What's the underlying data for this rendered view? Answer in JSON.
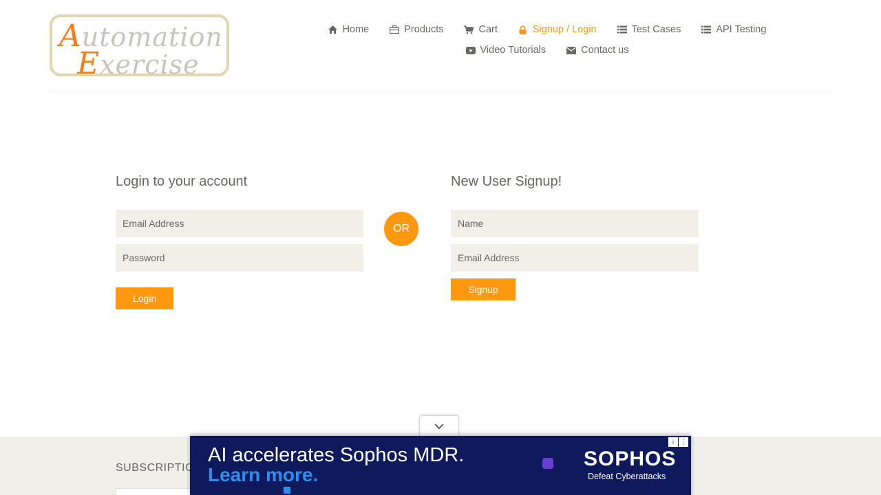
{
  "header": {
    "logo": {
      "line1": "Automation",
      "line2": "Exercise"
    },
    "nav": [
      {
        "label": "Home",
        "icon": "home-icon",
        "active": false
      },
      {
        "label": "Products",
        "icon": "briefcase-icon",
        "active": false
      },
      {
        "label": "Cart",
        "icon": "cart-icon",
        "active": false
      },
      {
        "label": "Signup / Login",
        "icon": "lock-icon",
        "active": true
      },
      {
        "label": "Test Cases",
        "icon": "list-icon",
        "active": false
      },
      {
        "label": "API Testing",
        "icon": "list-icon",
        "active": false
      },
      {
        "label": "Video Tutorials",
        "icon": "youtube-play-icon",
        "active": false
      },
      {
        "label": "Contact us",
        "icon": "envelope-icon",
        "active": false
      }
    ]
  },
  "login": {
    "title": "Login to your account",
    "email_placeholder": "Email Address",
    "password_placeholder": "Password",
    "button": "Login"
  },
  "or_label": "OR",
  "signup": {
    "title": "New User Signup!",
    "name_placeholder": "Name",
    "email_placeholder": "Email Address",
    "button": "Signup"
  },
  "footer": {
    "subscription_title": "SUBSCRIPTIO"
  },
  "ad": {
    "headline": "AI accelerates Sophos MDR.",
    "cta": "Learn more.",
    "brand": "SOPHOS",
    "tagline": "Defeat Cyberattacks"
  },
  "colors": {
    "accent": "#fe980f",
    "text": "#696763",
    "field_bg": "#f0f0e9",
    "ad_bg": "#0e1a5c",
    "ad_cta": "#2d8ff0"
  }
}
